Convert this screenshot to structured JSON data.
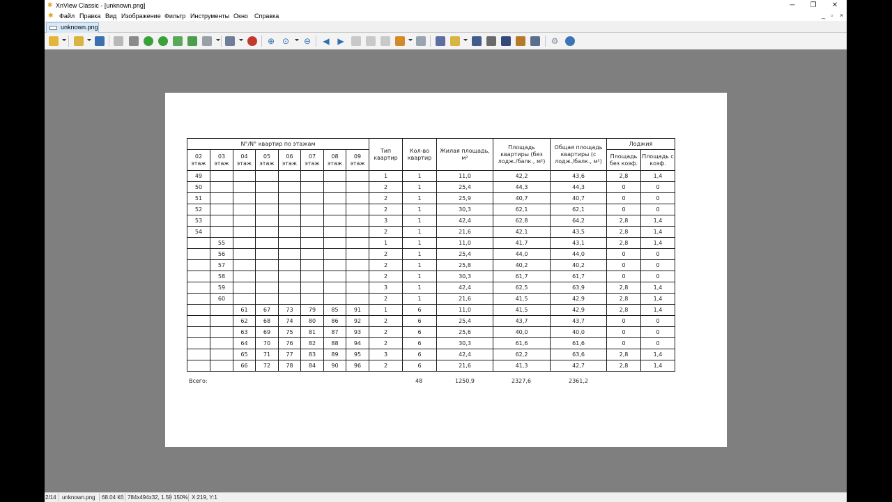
{
  "window": {
    "title": "XnView Classic - [unknown.png]",
    "minimize": "─",
    "restore": "❐",
    "close": "✕",
    "doc_minimize": "_",
    "doc_restore": "▫",
    "doc_close": "×"
  },
  "menu": [
    "Файл",
    "Правка",
    "Вид",
    "Изображение",
    "Фильтр",
    "Инструменты",
    "Окно",
    "Справка"
  ],
  "tab": {
    "label": "unknown.png"
  },
  "colors": {
    "viewer_bg": "#7f7f7f",
    "tab_bg": "#d7e8f6",
    "accent": "#2d6fb3"
  },
  "toolbar_icons": [
    "browser-icon",
    "open-icon",
    "save-icon",
    "undo-icon",
    "crop-icon",
    "rotate-left-icon",
    "rotate-right-icon",
    "export-icon",
    "import-icon",
    "batch-icon",
    "adjust-icon",
    "effect-icon",
    "zoom-in-icon",
    "zoom-fit-icon",
    "zoom-out-icon",
    "prev-icon",
    "next-icon",
    "first-icon",
    "last-icon",
    "slideshow-icon",
    "capture-icon",
    "fullscreen-icon",
    "compare-icon",
    "print-icon",
    "scanner-icon",
    "convert-icon",
    "web-icon",
    "settings-icon",
    "info-icon"
  ],
  "sheet": {
    "header_floors_group": "N°/N° квартир по этажам",
    "floors": [
      "02 этаж",
      "03 этаж",
      "04 этаж",
      "05 этаж",
      "06 этаж",
      "07 этаж",
      "08 этаж",
      "09 этаж"
    ],
    "col_type": "Тип квартир",
    "col_count": "Кол-во квартир",
    "col_living": "Жилая площадь, м²",
    "col_flat": "Площадь квартиры (без лодж./балк., м²)",
    "col_total": "Общая площадь квартиры (с лодж./балк., м²)",
    "col_loggia": "Лоджия",
    "col_loggia_no": "Площадь без коэф.",
    "col_loggia_k": "Площадь с коэф.",
    "rows": [
      [
        "49",
        "",
        "",
        "",
        "",
        "",
        "",
        "",
        "1",
        "1",
        "11,0",
        "42,2",
        "43,6",
        "2,8",
        "1,4"
      ],
      [
        "50",
        "",
        "",
        "",
        "",
        "",
        "",
        "",
        "2",
        "1",
        "25,4",
        "44,3",
        "44,3",
        "0",
        "0"
      ],
      [
        "51",
        "",
        "",
        "",
        "",
        "",
        "",
        "",
        "2",
        "1",
        "25,9",
        "40,7",
        "40,7",
        "0",
        "0"
      ],
      [
        "52",
        "",
        "",
        "",
        "",
        "",
        "",
        "",
        "2",
        "1",
        "30,3",
        "62,1",
        "62,1",
        "0",
        "0"
      ],
      [
        "53",
        "",
        "",
        "",
        "",
        "",
        "",
        "",
        "3",
        "1",
        "42,4",
        "62,8",
        "64,2",
        "2,8",
        "1,4"
      ],
      [
        "54",
        "",
        "",
        "",
        "",
        "",
        "",
        "",
        "2",
        "1",
        "21,6",
        "42,1",
        "43,5",
        "2,8",
        "1,4"
      ],
      [
        "",
        "55",
        "",
        "",
        "",
        "",
        "",
        "",
        "1",
        "1",
        "11,0",
        "41,7",
        "43,1",
        "2,8",
        "1,4"
      ],
      [
        "",
        "56",
        "",
        "",
        "",
        "",
        "",
        "",
        "2",
        "1",
        "25,4",
        "44,0",
        "44,0",
        "0",
        "0"
      ],
      [
        "",
        "57",
        "",
        "",
        "",
        "",
        "",
        "",
        "2",
        "1",
        "25,8",
        "40,2",
        "40,2",
        "0",
        "0"
      ],
      [
        "",
        "58",
        "",
        "",
        "",
        "",
        "",
        "",
        "2",
        "1",
        "30,3",
        "61,7",
        "61,7",
        "0",
        "0"
      ],
      [
        "",
        "59",
        "",
        "",
        "",
        "",
        "",
        "",
        "3",
        "1",
        "42,4",
        "62,5",
        "63,9",
        "2,8",
        "1,4"
      ],
      [
        "",
        "60",
        "",
        "",
        "",
        "",
        "",
        "",
        "2",
        "1",
        "21,6",
        "41,5",
        "42,9",
        "2,8",
        "1,4"
      ],
      [
        "",
        "",
        "61",
        "67",
        "73",
        "79",
        "85",
        "91",
        "1",
        "6",
        "11,0",
        "41,5",
        "42,9",
        "2,8",
        "1,4"
      ],
      [
        "",
        "",
        "62",
        "68",
        "74",
        "80",
        "86",
        "92",
        "2",
        "6",
        "25,4",
        "43,7",
        "43,7",
        "0",
        "0"
      ],
      [
        "",
        "",
        "63",
        "69",
        "75",
        "81",
        "87",
        "93",
        "2",
        "6",
        "25,6",
        "40,0",
        "40,0",
        "0",
        "0"
      ],
      [
        "",
        "",
        "64",
        "70",
        "76",
        "82",
        "88",
        "94",
        "2",
        "6",
        "30,3",
        "61,6",
        "61,6",
        "0",
        "0"
      ],
      [
        "",
        "",
        "65",
        "71",
        "77",
        "83",
        "89",
        "95",
        "3",
        "6",
        "42,4",
        "62,2",
        "63,6",
        "2,8",
        "1,4"
      ],
      [
        "",
        "",
        "66",
        "72",
        "78",
        "84",
        "90",
        "96",
        "2",
        "6",
        "21,6",
        "41,3",
        "42,7",
        "2,8",
        "1,4"
      ]
    ],
    "totals": {
      "label": "Всего:",
      "count": "48",
      "living": "1250,9",
      "flat": "2327,6",
      "total": "2361,2"
    }
  },
  "status": [
    "2/14",
    "unknown.png",
    "68.04 Кб",
    "784x494x32, 1.59",
    "150%",
    "X:219, Y:1"
  ]
}
